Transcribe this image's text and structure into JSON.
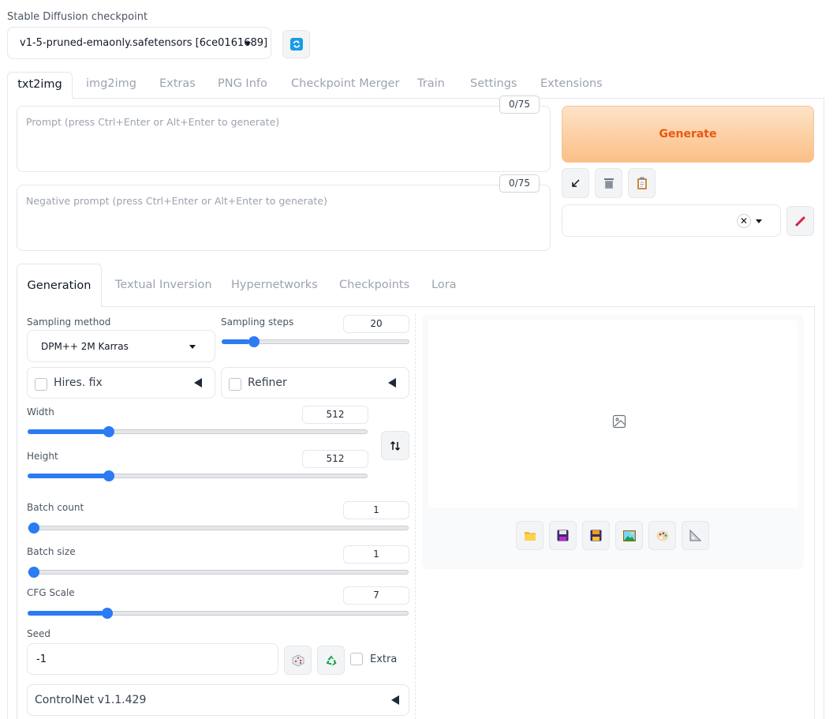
{
  "checkpoint": {
    "label": "Stable Diffusion checkpoint",
    "value": "v1-5-pruned-emaonly.safetensors [6ce0161689]"
  },
  "top_tabs": [
    "txt2img",
    "img2img",
    "Extras",
    "PNG Info",
    "Checkpoint Merger",
    "Train",
    "Settings",
    "Extensions"
  ],
  "prompt": {
    "placeholder": "Prompt (press Ctrl+Enter or Alt+Enter to generate)",
    "counter": "0/75"
  },
  "negative_prompt": {
    "placeholder": "Negative prompt (press Ctrl+Enter or Alt+Enter to generate)",
    "counter": "0/75"
  },
  "generate_label": "Generate",
  "sub_tabs": [
    "Generation",
    "Textual Inversion",
    "Hypernetworks",
    "Checkpoints",
    "Lora"
  ],
  "sampling": {
    "method_label": "Sampling method",
    "method_value": "DPM++ 2M Karras",
    "steps_label": "Sampling steps",
    "steps_value": "20",
    "steps_fraction": 0.15
  },
  "hires_fix_label": "Hires. fix",
  "refiner_label": "Refiner",
  "width": {
    "label": "Width",
    "value": "512",
    "fraction": 0.23
  },
  "height": {
    "label": "Height",
    "value": "512",
    "fraction": 0.23
  },
  "batch_count": {
    "label": "Batch count",
    "value": "1",
    "fraction": 0.0
  },
  "batch_size": {
    "label": "Batch size",
    "value": "1",
    "fraction": 0.0
  },
  "cfg_scale": {
    "label": "CFG Scale",
    "value": "7",
    "fraction": 0.2
  },
  "seed": {
    "label": "Seed",
    "value": "-1",
    "extra_label": "Extra"
  },
  "controlnet_label": "ControlNet v1.1.429",
  "colors": {
    "accent": "#2b7bf3",
    "generate_text": "#ea580c",
    "generate_bg_start": "#fde3c8",
    "generate_bg_end": "#fbbf86"
  },
  "icons": {
    "refresh": "refresh-icon",
    "arrow": "arrow-icon",
    "trash": "trash-icon",
    "clipboard": "clipboard-icon",
    "pencil": "pencil-icon",
    "swap": "swap-icon",
    "dice": "dice-icon",
    "recycle": "recycle-icon",
    "image": "image-placeholder-icon",
    "gallery": [
      "folder-icon",
      "save-icon",
      "zip-icon",
      "send-to-img2img-icon",
      "send-to-inpaint-icon",
      "send-to-extras-icon"
    ]
  }
}
